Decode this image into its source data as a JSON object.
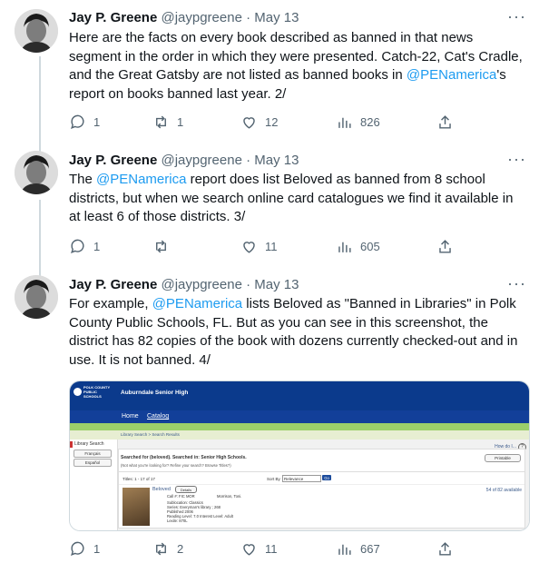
{
  "tweets": [
    {
      "name": "Jay P. Greene",
      "handle": "@jaypgreene",
      "sep": "·",
      "date": "May 13",
      "more": "···",
      "text": {
        "t1": "Here are the facts on every book described as banned in that news segment in the order in which they were presented. Catch-22, Cat's Cradle, and the Great Gatsby are not listed as banned books in ",
        "m1": "@PENamerica",
        "t2": "'s report on books banned last year. 2/"
      },
      "replies": "1",
      "retweets": "1",
      "likes": "12",
      "views": "826"
    },
    {
      "name": "Jay P. Greene",
      "handle": "@jaypgreene",
      "sep": "·",
      "date": "May 13",
      "more": "···",
      "text": {
        "t1": "The ",
        "m1": "@PENamerica",
        "t2": " report does list Beloved as banned from 8 school districts, but when we search online card catalogues we find it available in at least 6 of those districts. 3/"
      },
      "replies": "1",
      "retweets": "",
      "likes": "11",
      "views": "605"
    },
    {
      "name": "Jay P. Greene",
      "handle": "@jaypgreene",
      "sep": "·",
      "date": "May 13",
      "more": "···",
      "text": {
        "t1": "For example, ",
        "m1": "@PENamerica",
        "t2": " lists Beloved as \"Banned in Libraries\" in Polk County Public Schools, FL. But as you can see in this screenshot, the district has 82 copies of the book with dozens currently checked-out and in use. It is not banned. 4/"
      },
      "replies": "1",
      "retweets": "2",
      "likes": "11",
      "views": "667"
    }
  ],
  "media": {
    "logo": "POLK COUNTY PUBLIC SCHOOLS",
    "school": "Auburndale Senior High",
    "nav_home": "Home",
    "nav_catalog": "Catalog",
    "crumb": "Library Search > Search Results",
    "side_title": "Library Search",
    "lang1": "Français",
    "lang2": "Español",
    "help": "How do I...",
    "printable": "Printable",
    "search_for": "Searched for (beloved). Searched in: Senior High Schools.",
    "refine": "(Not what you're looking for? Refine your search? Browse Titles?)",
    "titles": "Titles: 1 - 17 of 17",
    "sort_by": "Sort By",
    "sort_val": "Relevance",
    "go": "Go",
    "book_title": "Beloved",
    "details": "Details",
    "call": "Call #: FIC MOR",
    "author": "Morrison, Toni.",
    "sub": "Sublocation: Classics",
    "series": "Series: Everyman's library ; 268",
    "published": "Published 2006",
    "reading": "Reading Level: 7.0  Interest Level: Adult",
    "lexile": "Lexile: 870L",
    "available": "54 of 82 available"
  }
}
